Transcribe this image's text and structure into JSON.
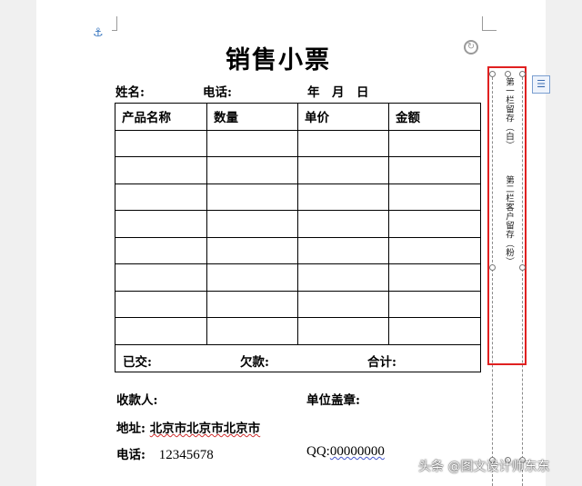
{
  "document": {
    "title": "销售小票",
    "header": {
      "name_label": "姓名:",
      "phone_label": "电话:",
      "date_label": "年　月　日"
    },
    "table": {
      "columns": [
        "产品名称",
        "数量",
        "单价",
        "金额"
      ],
      "empty_row_count": 8,
      "footer": {
        "paid_label": "已交:",
        "owed_label": "欠款:",
        "total_label": "合计:"
      }
    },
    "payee_label": "收款人:",
    "seal_label": "单位盖章:",
    "address_label": "地址:",
    "address_value": "北京市北京市北京市",
    "phone2_label": "电话:",
    "phone2_value": "12345678",
    "qq_label": "QQ:",
    "qq_value": "00000000"
  },
  "textbox": {
    "copy1": "第一栏留存（白）",
    "copy2": "第二栏客户留存（粉）"
  },
  "icons": {
    "anchor": "anchor-icon",
    "rotate": "rotate-handle-icon",
    "layout": "layout-options-icon"
  },
  "colors": {
    "selection_highlight": "#e02020",
    "spellcheck": "#d03030"
  },
  "watermark": "头条 @图文设计师东东"
}
